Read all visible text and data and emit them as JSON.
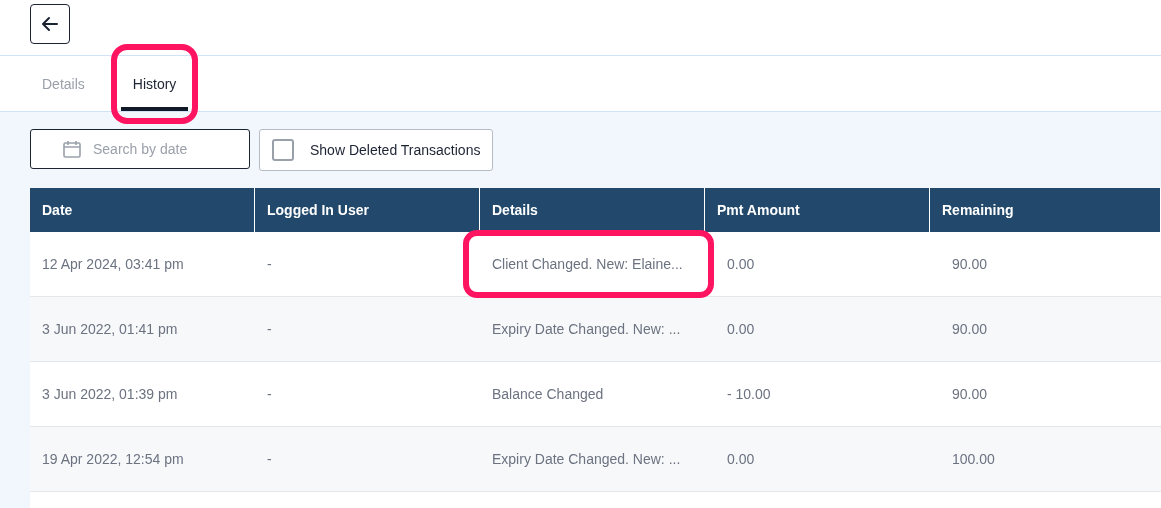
{
  "tabs": [
    {
      "label": "Details",
      "selected": false,
      "highlighted": false
    },
    {
      "label": "History",
      "selected": true,
      "highlighted": true
    }
  ],
  "date_search": {
    "placeholder": "Search by date"
  },
  "show_deleted": {
    "label": "Show Deleted Transactions",
    "checked": false
  },
  "table": {
    "columns": [
      "Date",
      "Logged In User",
      "Details",
      "Pmt Amount",
      "Remaining"
    ],
    "rows": [
      {
        "cells": [
          "12 Apr 2024, 03:41 pm",
          "-",
          "Client Changed. New: Elaine...",
          "0.00",
          "90.00"
        ],
        "details_highlighted": true
      },
      {
        "cells": [
          "3 Jun 2022, 01:41 pm",
          "-",
          "Expiry Date Changed. New: ...",
          "0.00",
          "90.00"
        ],
        "details_highlighted": false
      },
      {
        "cells": [
          "3 Jun 2022, 01:39 pm",
          "-",
          "Balance Changed",
          "- 10.00",
          "90.00"
        ],
        "details_highlighted": false
      },
      {
        "cells": [
          "19 Apr 2022, 12:54 pm",
          "-",
          "Expiry Date Changed. New: ...",
          "0.00",
          "100.00"
        ],
        "details_highlighted": false
      }
    ]
  }
}
